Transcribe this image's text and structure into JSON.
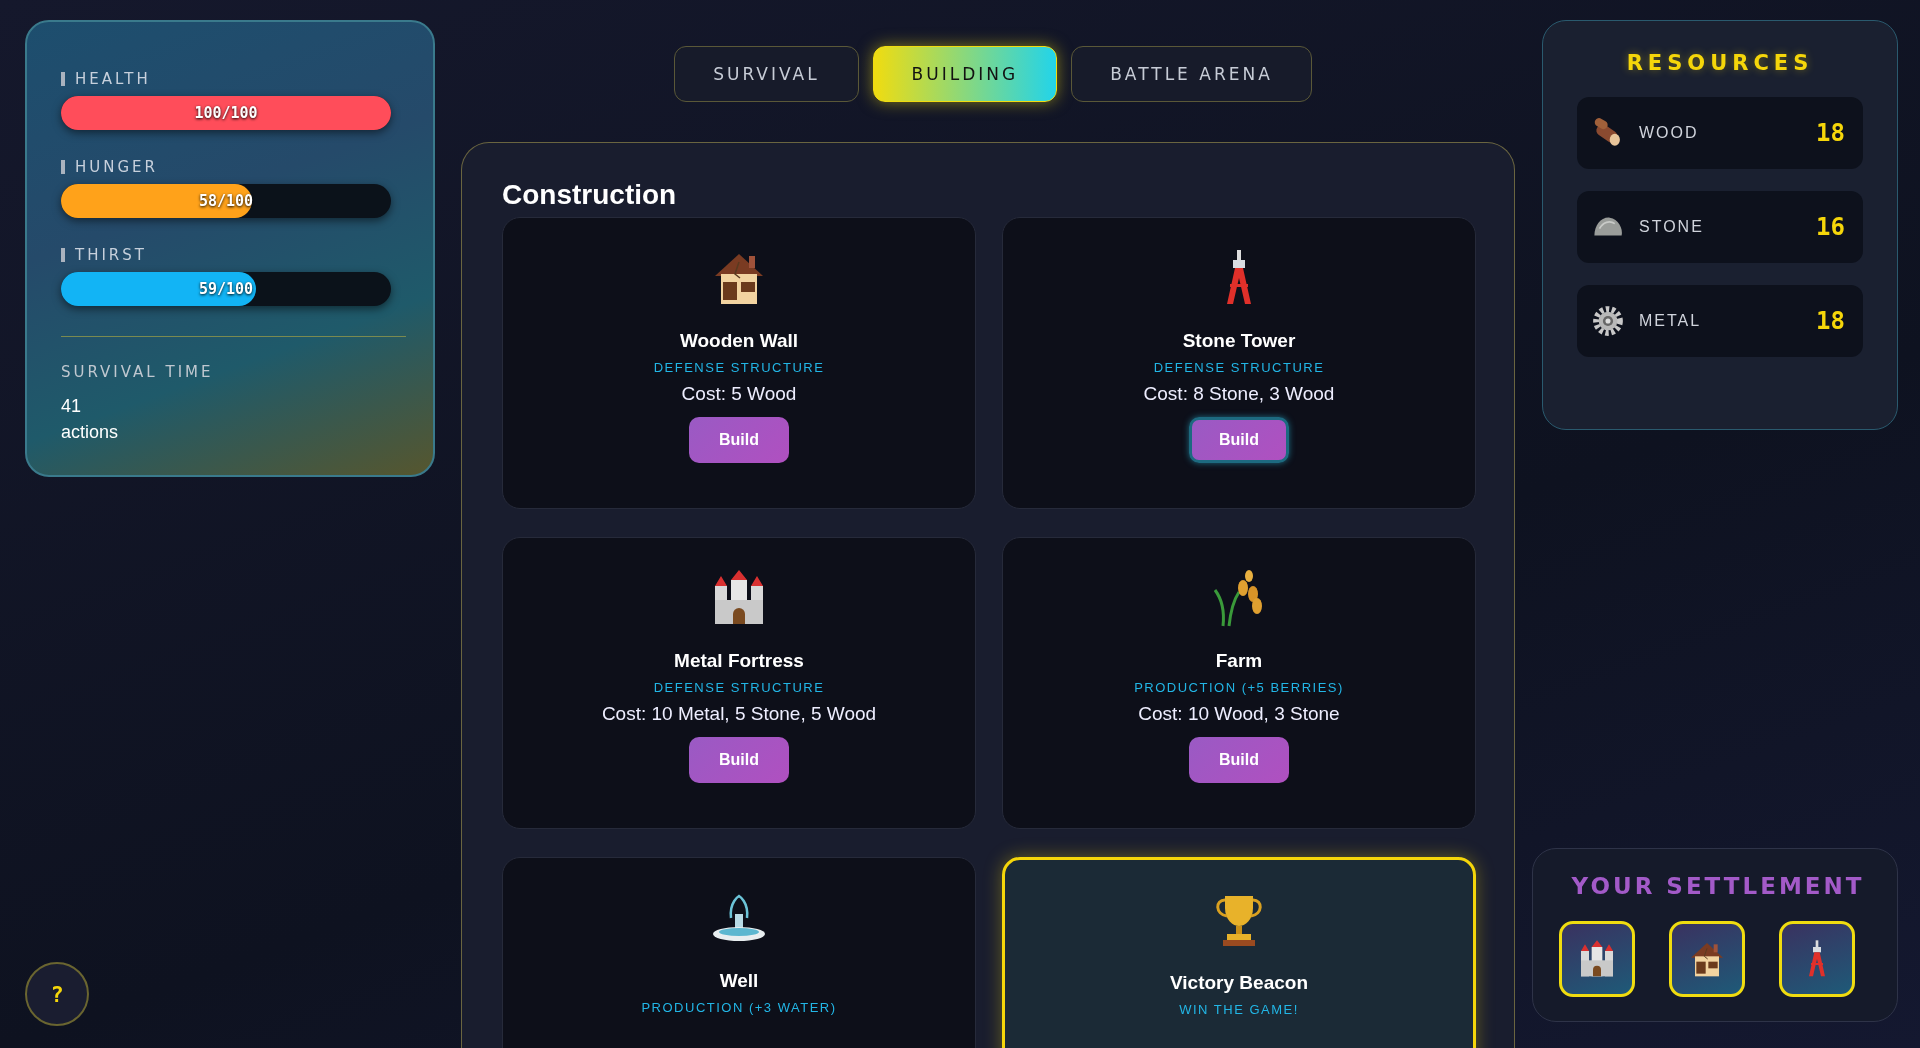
{
  "stats": [
    {
      "label": "HEALTH",
      "reading": "100/100",
      "level": 1.0,
      "color": "#ff4d5a"
    },
    {
      "label": "HUNGER",
      "reading": "58/100",
      "level": 0.58,
      "color": "#ffa21a"
    },
    {
      "label": "THIRST",
      "reading": "59/100",
      "level": 0.59,
      "color": "#12b4f5"
    }
  ],
  "survival": {
    "label": "SURVIVAL TIME",
    "value": "41",
    "unit": "actions"
  },
  "help_button": "?",
  "tabs": [
    {
      "label": "SURVIVAL",
      "selected": false
    },
    {
      "label": "BUILDING",
      "selected": true
    },
    {
      "label": "BATTLE ARENA",
      "selected": false
    }
  ],
  "construction": {
    "title": "Construction",
    "buildings": [
      {
        "kind": "wall",
        "name": "Wooden Wall",
        "category": "DEFENSE STRUCTURE",
        "cost": "Cost: 5 Wood",
        "button": "Build",
        "focused": false,
        "highlighted": false
      },
      {
        "kind": "tower",
        "name": "Stone Tower",
        "category": "DEFENSE STRUCTURE",
        "cost": "Cost: 8 Stone, 3 Wood",
        "button": "Build",
        "focused": true,
        "highlighted": false
      },
      {
        "kind": "fortress",
        "name": "Metal Fortress",
        "category": "DEFENSE STRUCTURE",
        "cost": "Cost: 10 Metal, 5 Stone, 5 Wood",
        "button": "Build",
        "focused": false,
        "highlighted": false
      },
      {
        "kind": "farm",
        "name": "Farm",
        "category": "PRODUCTION (+5 BERRIES)",
        "cost": "Cost: 10 Wood, 3 Stone",
        "button": "Build",
        "focused": false,
        "highlighted": false
      },
      {
        "kind": "well",
        "name": "Well",
        "category": "PRODUCTION (+3 WATER)",
        "highlighted": false
      },
      {
        "kind": "beacon",
        "name": "Victory Beacon",
        "category": "WIN THE GAME!",
        "highlighted": true
      }
    ]
  },
  "resources": {
    "title": "RESOURCES",
    "items": [
      {
        "kind": "wood",
        "name": "WOOD",
        "amount": "18"
      },
      {
        "kind": "stone",
        "name": "STONE",
        "amount": "16"
      },
      {
        "kind": "metal",
        "name": "METAL",
        "amount": "18"
      }
    ]
  },
  "settlement": {
    "title": "YOUR SETTLEMENT",
    "items": [
      {
        "kind": "fortress"
      },
      {
        "kind": "wall"
      },
      {
        "kind": "tower"
      }
    ]
  }
}
